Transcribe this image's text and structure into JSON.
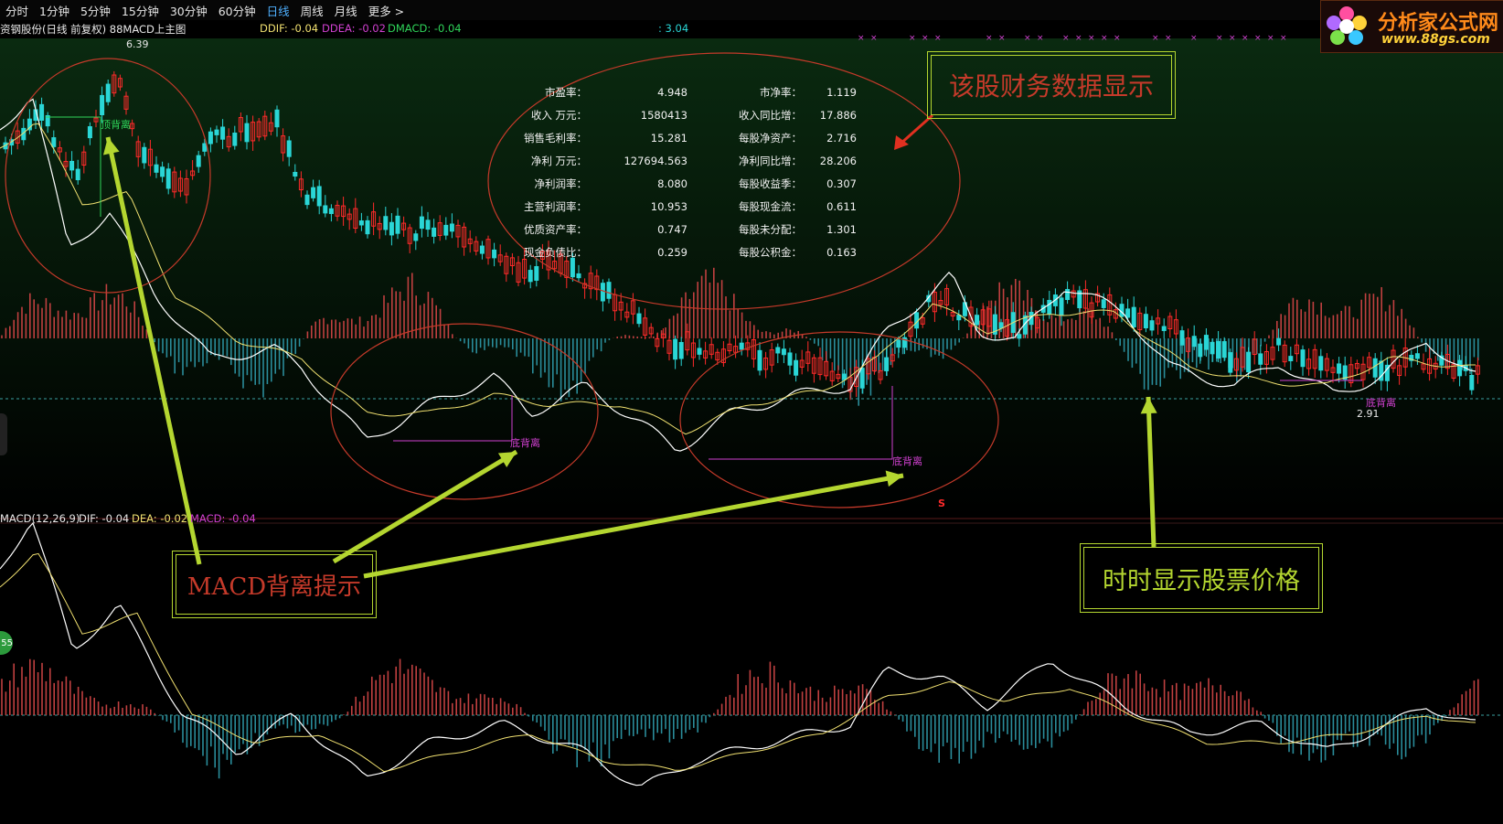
{
  "toolbar": {
    "items": [
      {
        "label": "分时",
        "active": false
      },
      {
        "label": "1分钟",
        "active": false
      },
      {
        "label": "5分钟",
        "active": false
      },
      {
        "label": "15分钟",
        "active": false
      },
      {
        "label": "30分钟",
        "active": false
      },
      {
        "label": "60分钟",
        "active": false
      },
      {
        "label": "日线",
        "active": true
      },
      {
        "label": "周线",
        "active": false
      },
      {
        "label": "月线",
        "active": false
      },
      {
        "label": "更多 >",
        "active": false
      }
    ]
  },
  "main_header": {
    "title": "资钢股份(日线 前复权) 88MACD上主图",
    "ddif": "DDIF: -0.04",
    "ddea": "DDEA: -0.02",
    "dmacd": "DMACD: -0.04",
    "extra": ": 3.04"
  },
  "sub_header": {
    "title": "MACD(12,26,9)",
    "dif": "DIF: -0.04",
    "dea": "DEA: -0.02",
    "macd": "MACD: -0.04"
  },
  "price_labels": {
    "high": "6.39",
    "low": "2.91"
  },
  "signals": {
    "top_divergence": "顶背离",
    "bottom_divergence_1": "底背离",
    "bottom_divergence_2": "底背离",
    "bottom_divergence_3": "底背离",
    "s_marker": "S"
  },
  "financials": {
    "rows": [
      {
        "l1": "市盈率：",
        "v1": "4.948",
        "l2": "市净率：",
        "v2": "1.119"
      },
      {
        "l1": "收入 万元：",
        "v1": "1580413",
        "l2": "收入同比增：",
        "v2": "17.886"
      },
      {
        "l1": "销售毛利率：",
        "v1": "15.281",
        "l2": "每股净资产：",
        "v2": "2.716"
      },
      {
        "l1": "净利 万元：",
        "v1": "127694.563",
        "l2": "净利同比增：",
        "v2": "28.206"
      },
      {
        "l1": "净利润率：",
        "v1": "8.080",
        "l2": "每股收益季：",
        "v2": "0.307"
      },
      {
        "l1": "主营利润率：",
        "v1": "10.953",
        "l2": "每股现金流：",
        "v2": "0.611"
      },
      {
        "l1": "优质资产率：",
        "v1": "0.747",
        "l2": "每股未分配：",
        "v2": "1.301"
      },
      {
        "l1": "现金负债比：",
        "v1": "0.259",
        "l2": "每股公积金：",
        "v2": "0.163"
      }
    ]
  },
  "callouts": {
    "financial": "该股财务数据显示",
    "macd": "MACD背离提示",
    "price": "时时显示股票价格"
  },
  "logo": {
    "text": "分析家公式网",
    "url": "www.88gs.com"
  },
  "badge": "55",
  "colors": {
    "up": "#ff2a2a",
    "down": "#2ad6d6",
    "white_line": "#ffffff",
    "yellow_line": "#f0e070",
    "annotation_green": "#b4d630",
    "annotation_red": "#c53a2a",
    "divergence_magenta": "#d040d0"
  }
}
